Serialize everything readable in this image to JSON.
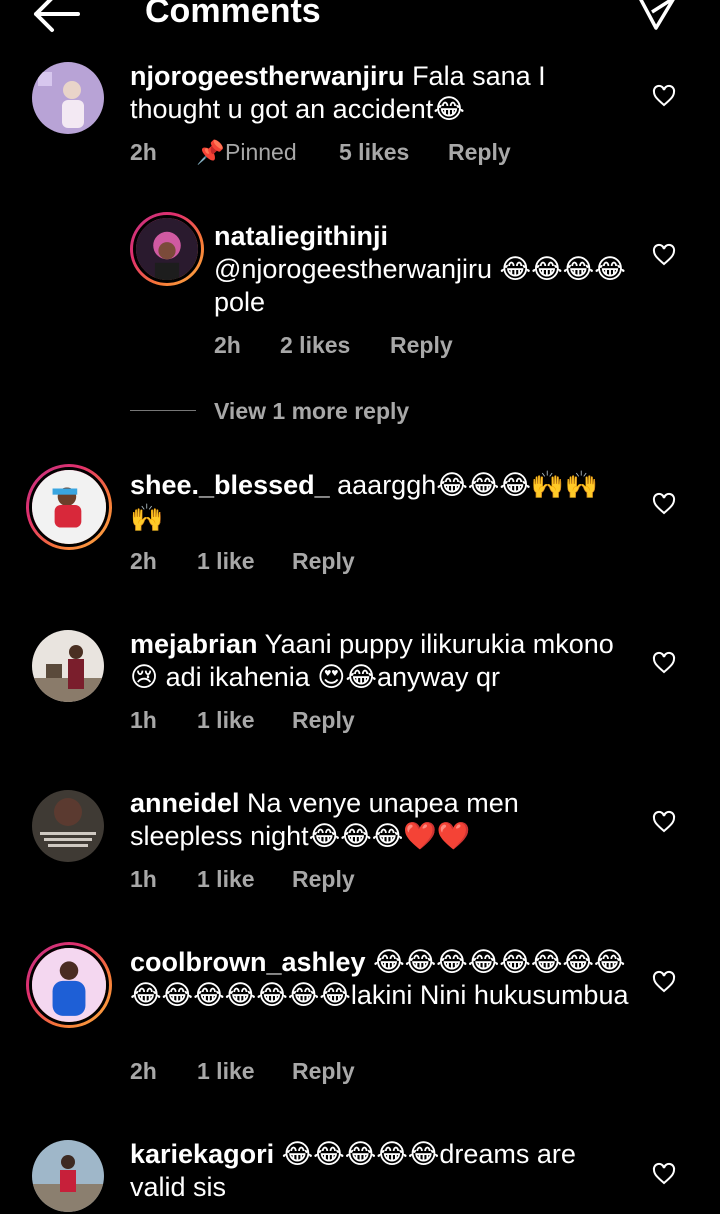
{
  "header": {
    "title": "Comments"
  },
  "comments": [
    {
      "username": "njorogeestherwanjiru",
      "text": " Fala sana I thought u got an accident😂",
      "time": "2h",
      "pinned_label": "Pinned",
      "likes": "5 likes",
      "reply": "Reply"
    },
    {
      "username": "nataliegithinji",
      "text": "@njorogeestherwanjiru 😂😂😂😂pole",
      "time": "2h",
      "likes": "2 likes",
      "reply": "Reply"
    },
    {
      "username": "shee._blessed_",
      "text": " aaarggh😂😂😂🙌🙌🙌",
      "time": "2h",
      "likes": "1 like",
      "reply": "Reply"
    },
    {
      "username": "mejabrian",
      "text": " Yaani puppy ilikurukia mkono 😢 adi ikahenia 😍😂anyway qr",
      "time": "1h",
      "likes": "1 like",
      "reply": "Reply"
    },
    {
      "username": "anneidel",
      "text": " Na venye unapea men sleepless night😂😂😂❤️❤️",
      "time": "1h",
      "likes": "1 like",
      "reply": "Reply"
    },
    {
      "username": "coolbrown_ashley",
      "text": " 😂😂😂😂😂😂😂😂😂😂😂😂😂😂😂lakini Nini hukusumbua",
      "time": "2h",
      "likes": "1 like",
      "reply": "Reply"
    },
    {
      "username": "kariekagori",
      "text": " 😂😂😂😂😂dreams are valid sis"
    }
  ],
  "view_more_replies": "View 1 more reply",
  "icons": {
    "back": "back-arrow-icon",
    "send": "send-icon",
    "heart": "heart-outline-icon",
    "pin": "pin-icon"
  },
  "colors": {
    "background": "#000000",
    "text": "#ffffff",
    "meta": "#a8a8a8"
  }
}
